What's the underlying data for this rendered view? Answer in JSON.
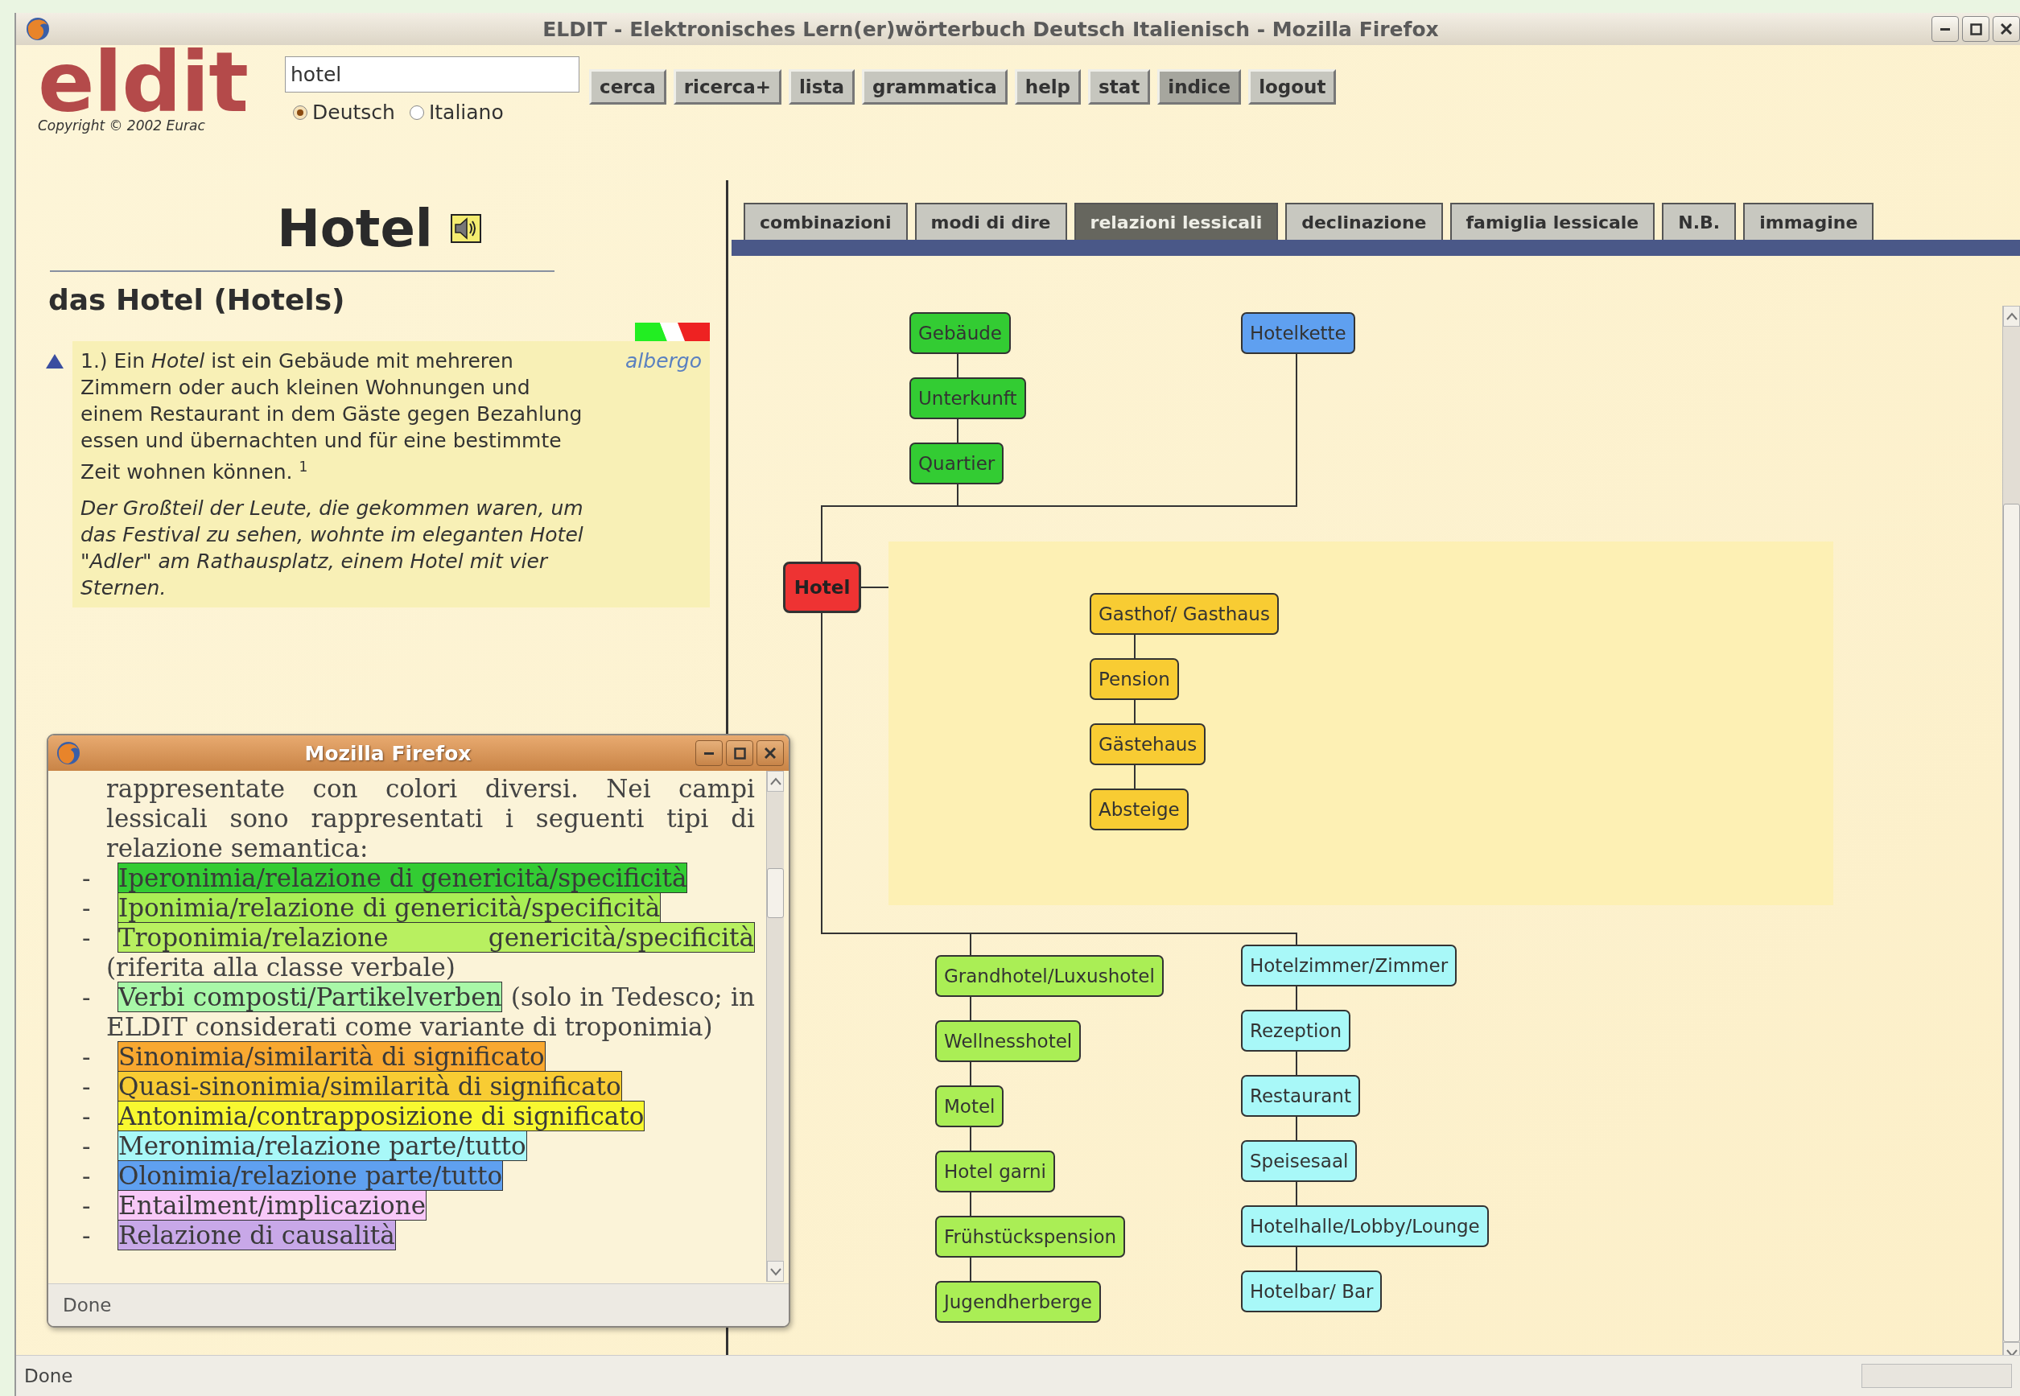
{
  "window": {
    "title": "ELDIT - Elektronisches Lern(er)wörterbuch Deutsch Italienisch - Mozilla Firefox",
    "status": "Done"
  },
  "header": {
    "logo": "eldit",
    "copyright": "Copyright © 2002 Eurac",
    "search": {
      "value": "hotel"
    },
    "languages": [
      {
        "label": "Deutsch",
        "selected": true
      },
      {
        "label": "Italiano",
        "selected": false
      }
    ],
    "buttons": [
      {
        "label": "cerca",
        "selected": false
      },
      {
        "label": "ricerca+",
        "selected": false
      },
      {
        "label": "lista",
        "selected": false
      },
      {
        "label": "grammatica",
        "selected": false
      },
      {
        "label": "help",
        "selected": false
      },
      {
        "label": "stat",
        "selected": false
      },
      {
        "label": "indice",
        "selected": true
      },
      {
        "label": "logout",
        "selected": false
      }
    ]
  },
  "entry": {
    "headword": "Hotel",
    "lemma": "das Hotel (Hotels)",
    "senses": [
      {
        "definition": "1.) Ein *Hotel* ist ein Gebäude mit mehreren Zimmern oder auch kleinen Wohnungen und einem Restaurant in dem Gäste gegen Bezahlung essen und übernachten und für eine bestimmte Zeit wohnen können. $^{1}$",
        "translation": "albergo",
        "example": "Der Großteil der Leute, die gekommen waren, um das Festival zu sehen, wohnte im eleganten Hotel \"Adler\" am Rathausplatz, einem Hotel mit vier Sternen."
      }
    ]
  },
  "tabs": [
    {
      "label": "combinazioni",
      "selected": false
    },
    {
      "label": "modi di dire",
      "selected": false
    },
    {
      "label": "relazioni lessicali",
      "selected": true
    },
    {
      "label": "declinazione",
      "selected": false
    },
    {
      "label": "famiglia lessicale",
      "selected": false
    },
    {
      "label": "N.B.",
      "selected": false
    },
    {
      "label": "immagine",
      "selected": false
    }
  ],
  "diagram": {
    "center": {
      "label": "Hotel",
      "color": "#ee3333"
    },
    "groups": [
      {
        "kind": "hypernyms",
        "color": "#33cc33",
        "nodes": [
          "Gebäude",
          "Unterkunft",
          "Quartier"
        ]
      },
      {
        "kind": "holonyms",
        "color": "#5fa0f0",
        "nodes": [
          "Hotelkette"
        ]
      },
      {
        "kind": "synonyms",
        "color": "#f8cc33",
        "nodes": [
          "Gasthof/ Gasthaus",
          "Pension",
          "Gästehaus",
          "Absteige"
        ]
      },
      {
        "kind": "hyponyms",
        "color": "#aaee55",
        "nodes": [
          "Grandhotel/Luxushotel",
          "Wellnesshotel",
          "Motel",
          "Hotel garni",
          "Frühstückspension",
          "Jugendherberge"
        ]
      },
      {
        "kind": "meronyms",
        "color": "#a8f8f8",
        "nodes": [
          "Hotelzimmer/Zimmer",
          "Rezeption",
          "Restaurant",
          "Speisesaal",
          "Hotelhalle/Lobby/Lounge",
          "Hotelbar/ Bar"
        ]
      }
    ]
  },
  "popup": {
    "title": "Mozilla Firefox",
    "intro": "rappresentate con colori diversi. Nei campi lessicali sono rappresentati i seguenti tipi di relazione semantica:",
    "status": "Done",
    "legend": [
      {
        "marker": "-",
        "term": "Iperonimia/relazione di genericità/specificità",
        "color": "#33cc33"
      },
      {
        "marker": "-",
        "term": "Iponimia/relazione di genericità/specificità",
        "color": "#aaee55"
      },
      {
        "marker": "-",
        "term": "Troponimia/relazione genericità/specificità",
        "note": "(riferita alla classe verbale)",
        "color": "#b8f060"
      },
      {
        "marker": "-",
        "term": "Verbi composti/Partikelverben",
        "note": "(solo in Tedesco; in ELDIT considerati come variante di troponimia)",
        "color": "#a8f8a8"
      },
      {
        "marker": "-",
        "term": "Sinonimia/similarità di significato",
        "color": "#f8a830"
      },
      {
        "marker": "-",
        "term": "Quasi-sinonimia/similarità di significato",
        "color": "#f8cc33"
      },
      {
        "marker": "-",
        "term": "Antonimia/contrapposizione di significato",
        "color": "#f8f830"
      },
      {
        "marker": "-",
        "term": "Meronimia/relazione parte/tutto",
        "color": "#a8f8f8"
      },
      {
        "marker": "-",
        "term": "Olonimia/relazione parte/tutto",
        "color": "#5fa0f0"
      },
      {
        "marker": "-",
        "term": "Entailment/implicazione",
        "color": "#f8c8f8"
      },
      {
        "marker": "-",
        "term": "Relazione di causalità",
        "color": "#c8a8e8"
      }
    ]
  }
}
